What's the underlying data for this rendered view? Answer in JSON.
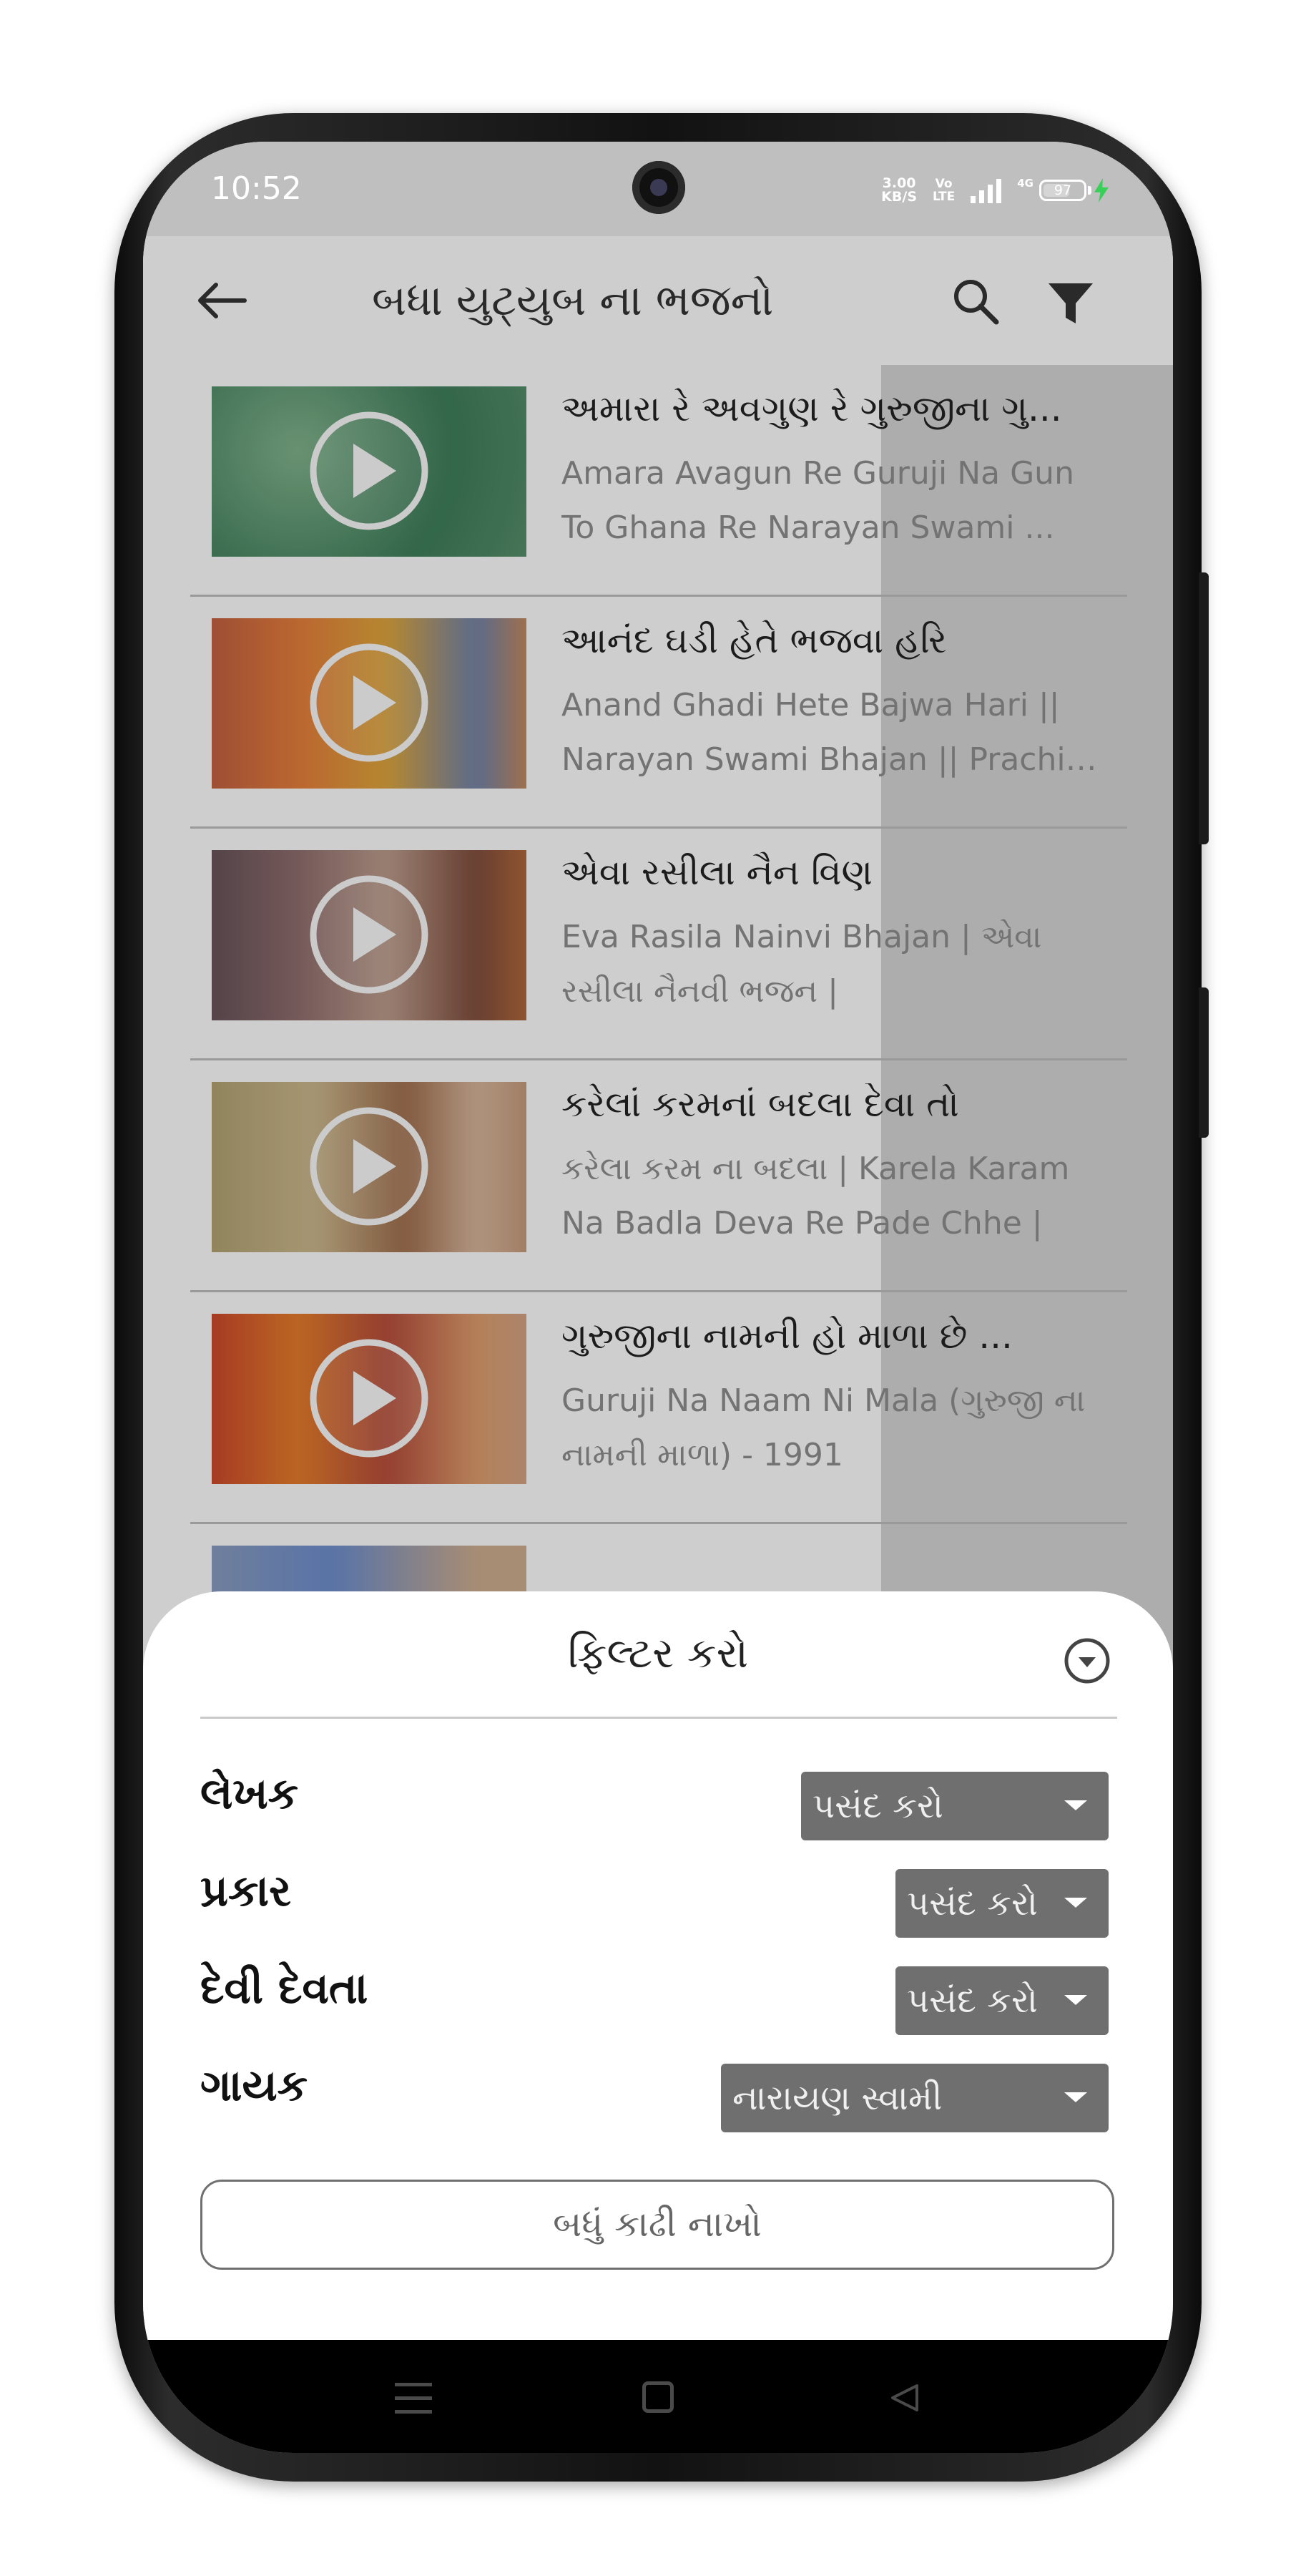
{
  "status_bar": {
    "time": "10:52",
    "speed_value": "3.00",
    "speed_unit": "KB/S",
    "volte_top": "Vo",
    "volte_bottom": "LTE",
    "network": "4G",
    "battery": "97"
  },
  "app_bar": {
    "title": "બધા યુટ્યુબ ના ભજનો",
    "back_icon": "arrow-left",
    "search_icon": "search",
    "filter_icon": "funnel"
  },
  "videos": [
    {
      "title": "અમારા રે અવગુણ રે ગુરુજીના ગુ...",
      "line1": "Amara Avagun Re Guruji Na Gun",
      "line2": "To Ghana Re Narayan Swami ..."
    },
    {
      "title": "આનંદ ઘડી હેતે ભજવા હરિ",
      "line1": "Anand Ghadi Hete Bajwa Hari ||",
      "line2": "Narayan Swami Bhajan || Prachin..."
    },
    {
      "title": "એવા રસીલા નૈન વિણ",
      "line1": "Eva Rasila Nainvi Bhajan | એવા",
      "line2": "રસીલા નૈનવી ભજન |"
    },
    {
      "title": "કરેલાં કરમનાં બદલા દેવા તો",
      "line1": "કરેલા કરમ ના બદલા | Karela Karam",
      "line2": "Na Badla Deva Re Pade Chhe |"
    },
    {
      "title": "ગુરુજીના નામની હો માળા છે ...",
      "line1": "Guruji Na Naam Ni Mala (ગુરુજી ના",
      "line2": "નામની માળા) - 1991"
    }
  ],
  "filter_sheet": {
    "title": "ફિલ્ટર કરો",
    "filters": [
      {
        "label": "લેખક",
        "value": "પસંદ કરો"
      },
      {
        "label": "પ્રકાર",
        "value": "પસંદ કરો"
      },
      {
        "label": "દેવી દેવતા",
        "value": "પસંદ કરો"
      },
      {
        "label": "ગાયક",
        "value": "નારાયણ સ્વામી"
      }
    ],
    "clear_label": "બધું કાઢી નાખો"
  },
  "colors": {
    "status_bar": "#bfbfbf",
    "select_bg": "#6f6f6f",
    "charging": "#39d05a"
  }
}
